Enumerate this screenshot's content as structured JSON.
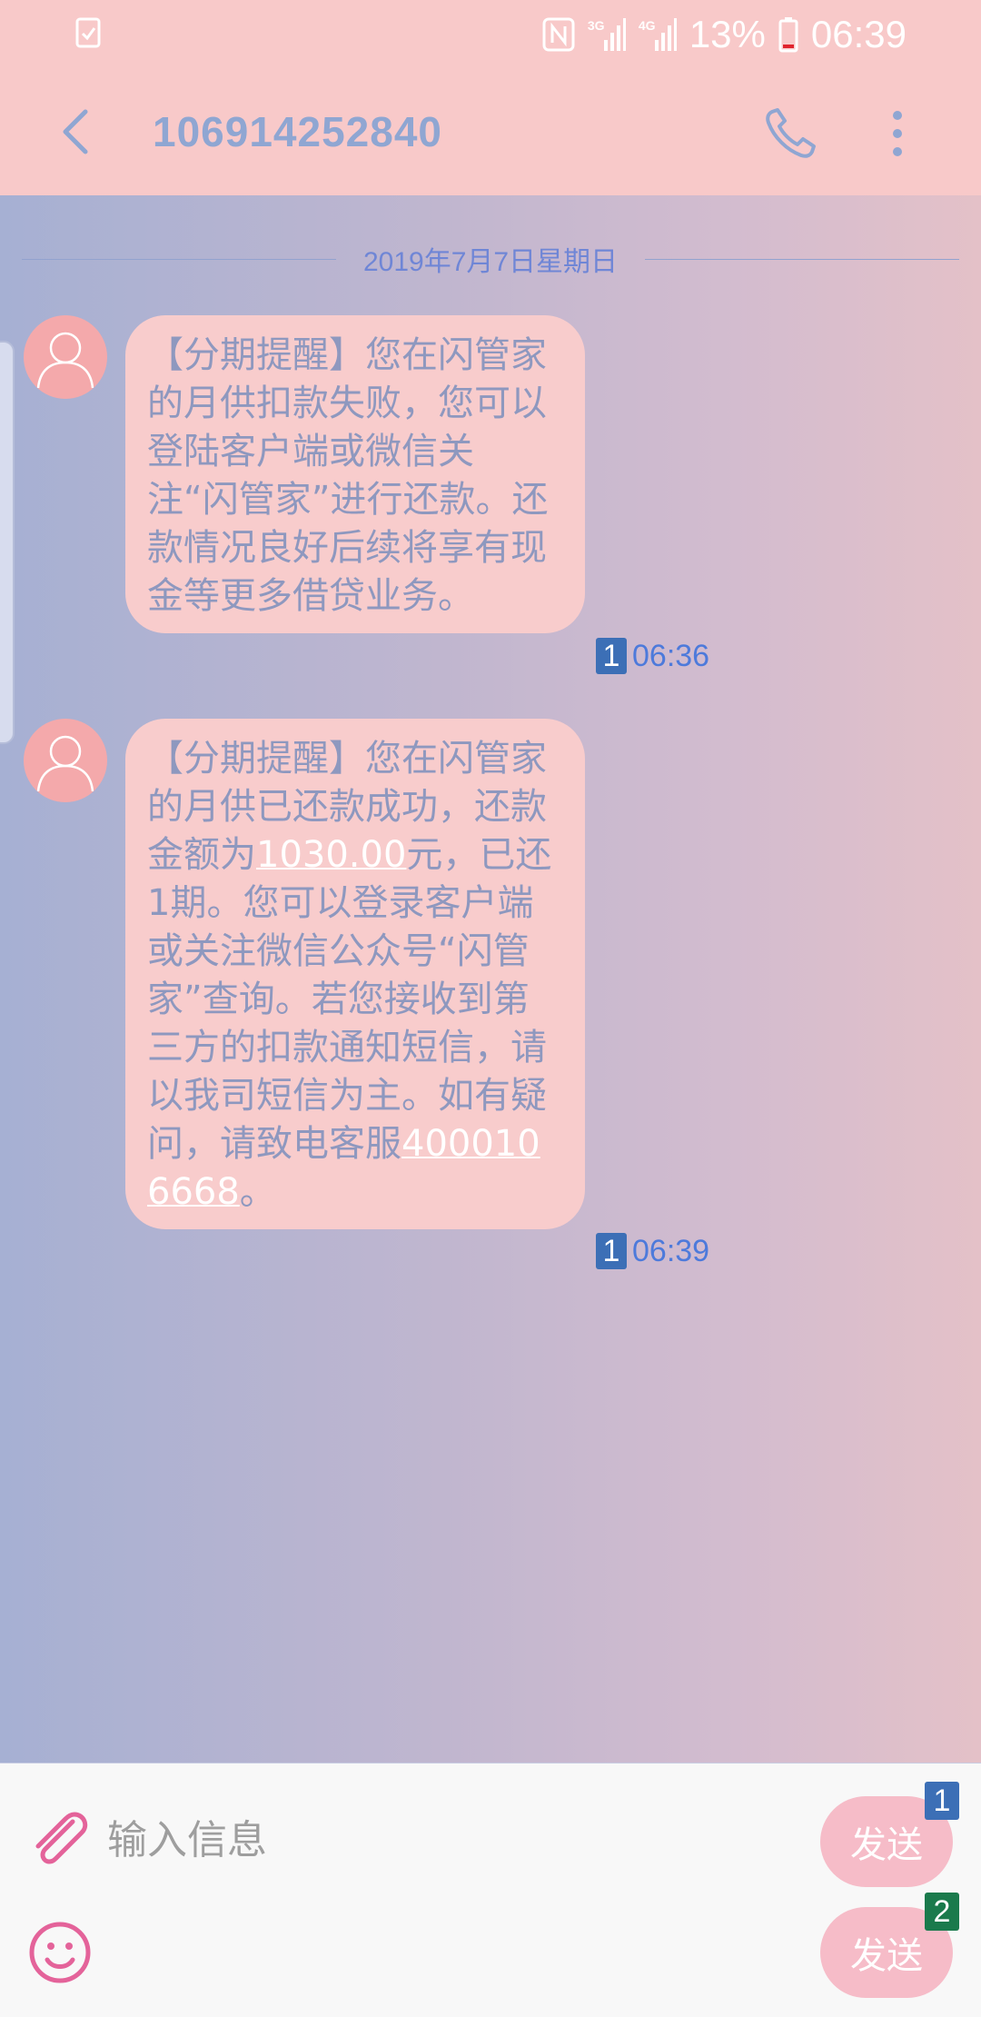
{
  "status_bar": {
    "left_icon": "clipboard-check-icon",
    "icons": [
      "nfc-icon",
      "signal-3g-icon",
      "signal-4g-icon"
    ],
    "net_label_1": "3G",
    "net_label_2": "4G",
    "battery_percent": "13%",
    "time": "06:39"
  },
  "header": {
    "title": "106914252840",
    "back_icon": "back-arrow-icon",
    "call_icon": "phone-icon",
    "more_icon": "more-vertical-icon"
  },
  "conversation": {
    "date_separator": "2019年7月7日星期日",
    "messages": [
      {
        "avatar_icon": "contact-avatar-icon",
        "text": "【分期提醒】您在闪管家的月供扣款失败，您可以登陆客户端或微信关注“闪管家”进行还款。还款情况良好后续将享有现金等更多借贷业务。",
        "sim": "1",
        "time": "06:36"
      },
      {
        "avatar_icon": "contact-avatar-icon",
        "text_before": "【分期提醒】您在闪管家的月供已还款成功，还款金额为",
        "amount_link": "1030.00",
        "text_middle": "元，已还1期。您可以登录客户端或关注微信公众号“闪管家”查询。若您接收到第三方的扣款通知短信，请以我司短信为主。如有疑问，请致电客服",
        "phone_link": "4000106668",
        "text_after": "。",
        "sim": "1",
        "time": "06:39"
      }
    ]
  },
  "composer": {
    "placeholder": "输入信息",
    "attach_icon": "paperclip-icon",
    "emoji_icon": "emoji-icon",
    "send_buttons": [
      {
        "label": "发送",
        "sim": "1"
      },
      {
        "label": "发送",
        "sim": "2"
      }
    ]
  },
  "colors": {
    "header_bg": "#f8c9c9",
    "title": "#8fa6d2",
    "bubble_bg": "#f8cccc",
    "bubble_text": "#8e98bf",
    "timestamp": "#4d7adb",
    "sim1_badge": "#3c6fb6",
    "sim2_badge": "#1a7a4c",
    "send_button": "#f6bcc8",
    "icon_pink": "#e4639a"
  }
}
